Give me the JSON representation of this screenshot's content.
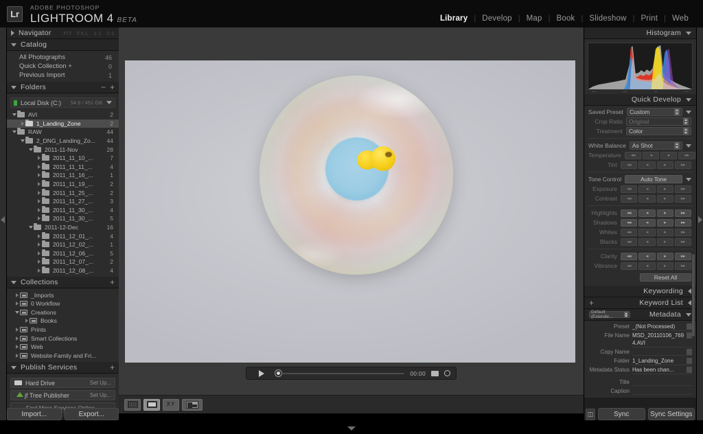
{
  "app": {
    "logo_text": "Lr",
    "brand_sub": "ADOBE PHOTOSHOP",
    "brand_main": "LIGHTROOM 4",
    "brand_beta": "BETA"
  },
  "modules": [
    {
      "label": "Library",
      "active": true
    },
    {
      "label": "Develop",
      "active": false
    },
    {
      "label": "Map",
      "active": false
    },
    {
      "label": "Book",
      "active": false
    },
    {
      "label": "Slideshow",
      "active": false
    },
    {
      "label": "Print",
      "active": false
    },
    {
      "label": "Web",
      "active": false
    }
  ],
  "navigator": {
    "title": "Navigator",
    "zooms": [
      "FIT",
      "FILL",
      "1:1",
      "2:1"
    ]
  },
  "catalog": {
    "title": "Catalog",
    "items": [
      {
        "label": "All Photographs",
        "count": "46"
      },
      {
        "label": "Quick Collection  +",
        "count": "0"
      },
      {
        "label": "Previous Import",
        "count": "1"
      }
    ]
  },
  "folders": {
    "title": "Folders",
    "disk": {
      "name": "Local Disk (C:)",
      "free": "54.9 / 451 GB"
    },
    "tree": [
      {
        "label": "AVI",
        "count": "2",
        "depth": 0,
        "tri": "down",
        "icon": "folder",
        "selected": false
      },
      {
        "label": "1_Landing_Zone",
        "count": "2",
        "depth": 1,
        "tri": "right",
        "icon": "folder-open",
        "selected": true
      },
      {
        "label": "RAW",
        "count": "44",
        "depth": 0,
        "tri": "down",
        "icon": "folder",
        "selected": false
      },
      {
        "label": "2_DNG_Landing_Zo...",
        "count": "44",
        "depth": 1,
        "tri": "down",
        "icon": "folder",
        "selected": false
      },
      {
        "label": "2011-11-Nov",
        "count": "28",
        "depth": 2,
        "tri": "down",
        "icon": "folder",
        "selected": false
      },
      {
        "label": "2011_11_10_...",
        "count": "7",
        "depth": 3,
        "tri": "right",
        "icon": "folder",
        "selected": false
      },
      {
        "label": "2011_11_11_...",
        "count": "4",
        "depth": 3,
        "tri": "right",
        "icon": "folder",
        "selected": false
      },
      {
        "label": "2011_11_16_...",
        "count": "1",
        "depth": 3,
        "tri": "right",
        "icon": "folder",
        "selected": false
      },
      {
        "label": "2011_11_19_...",
        "count": "2",
        "depth": 3,
        "tri": "right",
        "icon": "folder",
        "selected": false
      },
      {
        "label": "2011_11_25_...",
        "count": "2",
        "depth": 3,
        "tri": "right",
        "icon": "folder",
        "selected": false
      },
      {
        "label": "2011_11_27_...",
        "count": "3",
        "depth": 3,
        "tri": "right",
        "icon": "folder",
        "selected": false
      },
      {
        "label": "2011_11_30_...",
        "count": "4",
        "depth": 3,
        "tri": "right",
        "icon": "folder",
        "selected": false
      },
      {
        "label": "2011_11_30_...",
        "count": "5",
        "depth": 3,
        "tri": "right",
        "icon": "folder",
        "selected": false
      },
      {
        "label": "2011-12-Dec",
        "count": "16",
        "depth": 2,
        "tri": "down",
        "icon": "folder",
        "selected": false
      },
      {
        "label": "2011_12_01_...",
        "count": "4",
        "depth": 3,
        "tri": "right",
        "icon": "folder",
        "selected": false
      },
      {
        "label": "2011_12_02_...",
        "count": "1",
        "depth": 3,
        "tri": "right",
        "icon": "folder",
        "selected": false
      },
      {
        "label": "2011_12_06_...",
        "count": "5",
        "depth": 3,
        "tri": "right",
        "icon": "folder",
        "selected": false
      },
      {
        "label": "2011_12_07_...",
        "count": "2",
        "depth": 3,
        "tri": "right",
        "icon": "folder",
        "selected": false
      },
      {
        "label": "2011_12_08_...",
        "count": "4",
        "depth": 3,
        "tri": "right",
        "icon": "folder",
        "selected": false
      }
    ]
  },
  "collections": {
    "title": "Collections",
    "items": [
      {
        "label": "_Imports",
        "depth": 0,
        "tri": "right"
      },
      {
        "label": "0 Workflow",
        "depth": 0,
        "tri": "right"
      },
      {
        "label": "Creations",
        "depth": 0,
        "tri": "down"
      },
      {
        "label": "Books",
        "depth": 1,
        "tri": "right"
      },
      {
        "label": "Prints",
        "depth": 0,
        "tri": "right"
      },
      {
        "label": "Smart Collections",
        "depth": 0,
        "tri": "right"
      },
      {
        "label": "Web",
        "depth": 0,
        "tri": "right"
      },
      {
        "label": "Website-Family and Fri...",
        "depth": 0,
        "tri": "right"
      }
    ]
  },
  "publish": {
    "title": "Publish Services",
    "services": [
      {
        "label": "Hard Drive",
        "action": "Set Up...",
        "icon": "hard-drive-icon"
      },
      {
        "label": "jf Tree Publisher",
        "action": "Set Up...",
        "icon": "tree-icon"
      }
    ],
    "find_more": "Find More Services Online..."
  },
  "left_buttons": {
    "import": "Import...",
    "export": "Export..."
  },
  "histogram": {
    "title": "Histogram"
  },
  "quick_develop": {
    "title": "Quick Develop",
    "saved_preset": {
      "label": "Saved Preset",
      "value": "Custom"
    },
    "crop_ratio": {
      "label": "Crop Ratio",
      "value": "Original"
    },
    "treatment": {
      "label": "Treatment",
      "value": "Color"
    },
    "white_balance": {
      "label": "White Balance",
      "value": "As Shot"
    },
    "temperature": {
      "label": "Temperature"
    },
    "tint": {
      "label": "Tint"
    },
    "tone_control": {
      "label": "Tone Control",
      "auto_tone": "Auto Tone"
    },
    "exposure": {
      "label": "Exposure"
    },
    "contrast": {
      "label": "Contrast"
    },
    "highlights": {
      "label": "Highlights"
    },
    "shadows": {
      "label": "Shadows"
    },
    "whites": {
      "label": "Whites"
    },
    "blacks": {
      "label": "Blacks"
    },
    "clarity": {
      "label": "Clarity"
    },
    "vibrance": {
      "label": "Vibrance"
    },
    "reset_all": "Reset All",
    "step_labels": [
      "◂◂",
      "◂",
      "▸",
      "▸▸"
    ]
  },
  "keywording": {
    "title": "Keywording"
  },
  "keyword_list": {
    "title": "Keyword List",
    "add": "+"
  },
  "metadata": {
    "title": "Metadata",
    "view_preset": "Default (Extende...",
    "rows": [
      {
        "key": "Preset",
        "value": "_(Not Processed)",
        "button": true
      },
      {
        "key": "File Name",
        "value": "MSD_20110106_7694.AVI",
        "button": true
      },
      {
        "key": "Copy Name",
        "value": "",
        "button": true
      },
      {
        "key": "Folder",
        "value": "1_Landing_Zone",
        "button": true
      },
      {
        "key": "Metadata Status",
        "value": "Has been chan...",
        "button": true
      },
      {
        "key": "Title",
        "value": "",
        "button": false
      },
      {
        "key": "Caption",
        "value": "",
        "button": false
      }
    ]
  },
  "right_buttons": {
    "sync": "Sync",
    "sync_settings": "Sync Settings"
  },
  "video_bar": {
    "time": "00:00",
    "play": "play-icon"
  },
  "toolbar": {
    "views": [
      {
        "name": "grid-view",
        "active": false
      },
      {
        "name": "loupe-view",
        "active": true
      },
      {
        "name": "compare-view",
        "active": false,
        "label": "XY"
      },
      {
        "name": "survey-view",
        "active": false
      }
    ]
  },
  "colors": {
    "panel_bg": "#2c2c2c",
    "chrome_bg": "#1f1f1f",
    "accent_text": "#f2f2f2",
    "selected_row": "#4d4d4d",
    "disk_led_green": "#3ca83c"
  }
}
